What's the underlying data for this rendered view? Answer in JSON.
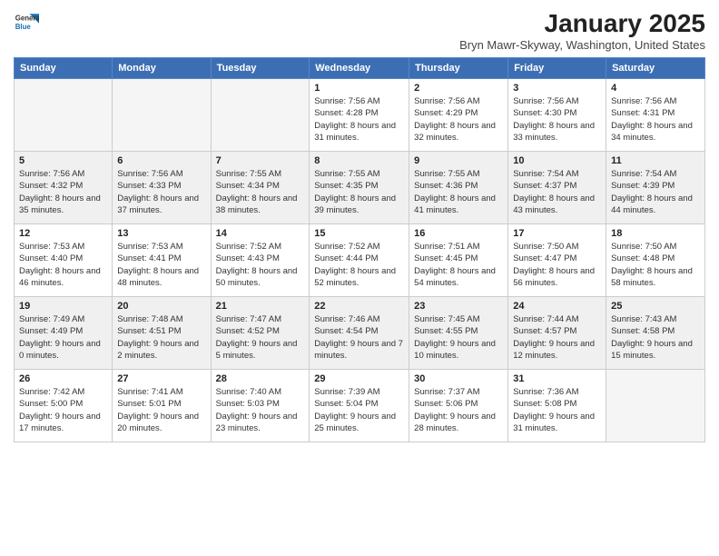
{
  "header": {
    "title": "January 2025",
    "location": "Bryn Mawr-Skyway, Washington, United States",
    "logo_general": "General",
    "logo_blue": "Blue"
  },
  "calendar": {
    "days_of_week": [
      "Sunday",
      "Monday",
      "Tuesday",
      "Wednesday",
      "Thursday",
      "Friday",
      "Saturday"
    ],
    "weeks": [
      [
        {
          "day": "",
          "empty": true
        },
        {
          "day": "",
          "empty": true
        },
        {
          "day": "",
          "empty": true
        },
        {
          "day": "1",
          "sunrise": "7:56 AM",
          "sunset": "4:28 PM",
          "daylight": "8 hours and 31 minutes."
        },
        {
          "day": "2",
          "sunrise": "7:56 AM",
          "sunset": "4:29 PM",
          "daylight": "8 hours and 32 minutes."
        },
        {
          "day": "3",
          "sunrise": "7:56 AM",
          "sunset": "4:30 PM",
          "daylight": "8 hours and 33 minutes."
        },
        {
          "day": "4",
          "sunrise": "7:56 AM",
          "sunset": "4:31 PM",
          "daylight": "8 hours and 34 minutes."
        }
      ],
      [
        {
          "day": "5",
          "sunrise": "7:56 AM",
          "sunset": "4:32 PM",
          "daylight": "8 hours and 35 minutes.",
          "shaded": true
        },
        {
          "day": "6",
          "sunrise": "7:56 AM",
          "sunset": "4:33 PM",
          "daylight": "8 hours and 37 minutes.",
          "shaded": true
        },
        {
          "day": "7",
          "sunrise": "7:55 AM",
          "sunset": "4:34 PM",
          "daylight": "8 hours and 38 minutes.",
          "shaded": true
        },
        {
          "day": "8",
          "sunrise": "7:55 AM",
          "sunset": "4:35 PM",
          "daylight": "8 hours and 39 minutes.",
          "shaded": true
        },
        {
          "day": "9",
          "sunrise": "7:55 AM",
          "sunset": "4:36 PM",
          "daylight": "8 hours and 41 minutes.",
          "shaded": true
        },
        {
          "day": "10",
          "sunrise": "7:54 AM",
          "sunset": "4:37 PM",
          "daylight": "8 hours and 43 minutes.",
          "shaded": true
        },
        {
          "day": "11",
          "sunrise": "7:54 AM",
          "sunset": "4:39 PM",
          "daylight": "8 hours and 44 minutes.",
          "shaded": true
        }
      ],
      [
        {
          "day": "12",
          "sunrise": "7:53 AM",
          "sunset": "4:40 PM",
          "daylight": "8 hours and 46 minutes."
        },
        {
          "day": "13",
          "sunrise": "7:53 AM",
          "sunset": "4:41 PM",
          "daylight": "8 hours and 48 minutes."
        },
        {
          "day": "14",
          "sunrise": "7:52 AM",
          "sunset": "4:43 PM",
          "daylight": "8 hours and 50 minutes."
        },
        {
          "day": "15",
          "sunrise": "7:52 AM",
          "sunset": "4:44 PM",
          "daylight": "8 hours and 52 minutes."
        },
        {
          "day": "16",
          "sunrise": "7:51 AM",
          "sunset": "4:45 PM",
          "daylight": "8 hours and 54 minutes."
        },
        {
          "day": "17",
          "sunrise": "7:50 AM",
          "sunset": "4:47 PM",
          "daylight": "8 hours and 56 minutes."
        },
        {
          "day": "18",
          "sunrise": "7:50 AM",
          "sunset": "4:48 PM",
          "daylight": "8 hours and 58 minutes."
        }
      ],
      [
        {
          "day": "19",
          "sunrise": "7:49 AM",
          "sunset": "4:49 PM",
          "daylight": "9 hours and 0 minutes.",
          "shaded": true
        },
        {
          "day": "20",
          "sunrise": "7:48 AM",
          "sunset": "4:51 PM",
          "daylight": "9 hours and 2 minutes.",
          "shaded": true
        },
        {
          "day": "21",
          "sunrise": "7:47 AM",
          "sunset": "4:52 PM",
          "daylight": "9 hours and 5 minutes.",
          "shaded": true
        },
        {
          "day": "22",
          "sunrise": "7:46 AM",
          "sunset": "4:54 PM",
          "daylight": "9 hours and 7 minutes.",
          "shaded": true
        },
        {
          "day": "23",
          "sunrise": "7:45 AM",
          "sunset": "4:55 PM",
          "daylight": "9 hours and 10 minutes.",
          "shaded": true
        },
        {
          "day": "24",
          "sunrise": "7:44 AM",
          "sunset": "4:57 PM",
          "daylight": "9 hours and 12 minutes.",
          "shaded": true
        },
        {
          "day": "25",
          "sunrise": "7:43 AM",
          "sunset": "4:58 PM",
          "daylight": "9 hours and 15 minutes.",
          "shaded": true
        }
      ],
      [
        {
          "day": "26",
          "sunrise": "7:42 AM",
          "sunset": "5:00 PM",
          "daylight": "9 hours and 17 minutes."
        },
        {
          "day": "27",
          "sunrise": "7:41 AM",
          "sunset": "5:01 PM",
          "daylight": "9 hours and 20 minutes."
        },
        {
          "day": "28",
          "sunrise": "7:40 AM",
          "sunset": "5:03 PM",
          "daylight": "9 hours and 23 minutes."
        },
        {
          "day": "29",
          "sunrise": "7:39 AM",
          "sunset": "5:04 PM",
          "daylight": "9 hours and 25 minutes."
        },
        {
          "day": "30",
          "sunrise": "7:37 AM",
          "sunset": "5:06 PM",
          "daylight": "9 hours and 28 minutes."
        },
        {
          "day": "31",
          "sunrise": "7:36 AM",
          "sunset": "5:08 PM",
          "daylight": "9 hours and 31 minutes."
        },
        {
          "day": "",
          "empty": true
        }
      ]
    ]
  }
}
